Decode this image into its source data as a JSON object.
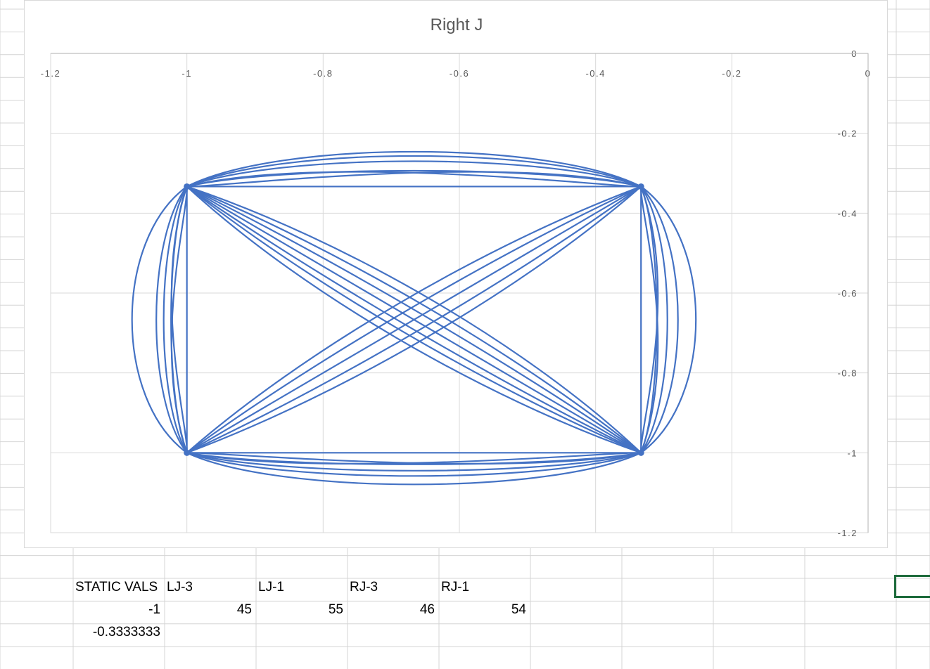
{
  "sheet": {
    "cells": [
      {
        "row": 1,
        "col": 1,
        "text": "STATIC VALS"
      },
      {
        "row": 1,
        "col": 2,
        "text": "LJ-3"
      },
      {
        "row": 1,
        "col": 3,
        "text": "LJ-1"
      },
      {
        "row": 1,
        "col": 4,
        "text": "RJ-3"
      },
      {
        "row": 1,
        "col": 5,
        "text": "RJ-1"
      },
      {
        "row": 2,
        "col": 1,
        "text": "-1",
        "numeric": true
      },
      {
        "row": 2,
        "col": 2,
        "text": "45",
        "numeric": true
      },
      {
        "row": 2,
        "col": 3,
        "text": "55",
        "numeric": true
      },
      {
        "row": 2,
        "col": 4,
        "text": "46",
        "numeric": true
      },
      {
        "row": 2,
        "col": 5,
        "text": "54",
        "numeric": true
      },
      {
        "row": 3,
        "col": 1,
        "text": "-0.3333333",
        "numeric": true
      }
    ]
  },
  "chart_data": {
    "type": "scatter",
    "title": "Right J",
    "xlabel": "",
    "ylabel": "",
    "xlim": [
      -1.2,
      0
    ],
    "ylim": [
      -1.2,
      0
    ],
    "x_ticks": [
      "-1.2",
      "-1",
      "-0.8",
      "-0.6",
      "-0.4",
      "-0.2",
      "0"
    ],
    "y_ticks": [
      "0",
      "-0.2",
      "-0.4",
      "-0.6",
      "-0.8",
      "-1",
      "-1.2"
    ],
    "grid": true,
    "legend": "none",
    "series_color": "#4472c4",
    "points": [
      {
        "x": -1,
        "y": -0.3333333
      },
      {
        "x": -0.3333333,
        "y": -0.3333333
      },
      {
        "x": -1,
        "y": -1
      },
      {
        "x": -0.3333333,
        "y": -1
      }
    ]
  }
}
